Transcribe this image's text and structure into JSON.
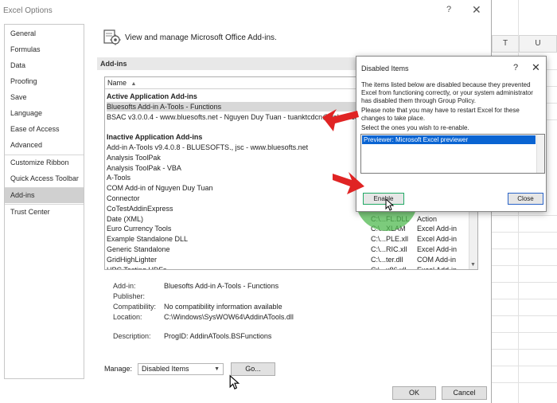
{
  "window": {
    "title": "Excel Options",
    "help": "?",
    "close": "✕"
  },
  "nav": {
    "items": [
      {
        "label": "General"
      },
      {
        "label": "Formulas"
      },
      {
        "label": "Data"
      },
      {
        "label": "Proofing"
      },
      {
        "label": "Save"
      },
      {
        "label": "Language"
      },
      {
        "label": "Ease of Access"
      },
      {
        "label": "Advanced"
      },
      {
        "label": "Customize Ribbon"
      },
      {
        "label": "Quick Access Toolbar"
      },
      {
        "label": "Add-ins"
      },
      {
        "label": "Trust Center"
      }
    ],
    "selected": "Add-ins"
  },
  "main": {
    "header": "View and manage Microsoft Office Add-ins.",
    "section": "Add-ins",
    "list_header": "Name",
    "rows": [
      {
        "name": "Active Application Add-ins",
        "loc": "",
        "type": "",
        "group": true
      },
      {
        "name": "Bluesofts Add-in A-Tools - Functions",
        "loc": "",
        "type": "",
        "hl": true
      },
      {
        "name": "BSAC v3.0.0.4 - www.bluesofts.net - Nguyen Duy Tuan - tuanktcdcn@yahoo.com",
        "loc": "",
        "type": ""
      },
      {
        "name": "",
        "loc": "",
        "type": ""
      },
      {
        "name": "Inactive Application Add-ins",
        "loc": "",
        "type": "",
        "group": true
      },
      {
        "name": "Add-in A-Tools v9.4.0.8 - BLUESOFTS., jsc - www.bluesofts.net",
        "loc": "",
        "type": ""
      },
      {
        "name": "Analysis ToolPak",
        "loc": "",
        "type": ""
      },
      {
        "name": "Analysis ToolPak - VBA",
        "loc": "",
        "type": ""
      },
      {
        "name": "A-Tools",
        "loc": "",
        "type": ""
      },
      {
        "name": "COM Add-in of Nguyen Duy Tuan",
        "loc": "",
        "type": ""
      },
      {
        "name": "Connector",
        "loc": "",
        "type": ""
      },
      {
        "name": "CoTestAddinExpress",
        "loc": "",
        "type": ""
      },
      {
        "name": "Date (XML)",
        "loc": "C:\\...FL.DLL",
        "type": "Action"
      },
      {
        "name": "Euro Currency Tools",
        "loc": "C:\\...XLAM",
        "type": "Excel Add-in"
      },
      {
        "name": "Example Standalone DLL",
        "loc": "C:\\...PLE.xll",
        "type": "Excel Add-in"
      },
      {
        "name": "Generic Standalone",
        "loc": "C:\\...RIC.xll",
        "type": "Excel Add-in"
      },
      {
        "name": "GridHighLighter",
        "loc": "C:\\...ter.dll",
        "type": "COM Add-in"
      },
      {
        "name": "HPC Testing UDFs",
        "loc": "C:\\...x86.xll",
        "type": "Excel Add-in"
      }
    ],
    "details": [
      {
        "label": "Add-in:",
        "value": "Bluesofts Add-in A-Tools - Functions"
      },
      {
        "label": "Publisher:",
        "value": ""
      },
      {
        "label": "Compatibility:",
        "value": "No compatibility information available"
      },
      {
        "label": "Location:",
        "value": "C:\\Windows\\SysWOW64\\AddinATools.dll"
      },
      {
        "label": "Description:",
        "value": "ProgID: AddinATools.BSFunctions"
      }
    ],
    "manage_label": "Manage:",
    "manage_value": "Disabled Items",
    "go_label": "Go...",
    "ok_label": "OK",
    "cancel_label": "Cancel"
  },
  "popup": {
    "title": "Disabled Items",
    "help": "?",
    "close": "✕",
    "text1": "The items listed below are disabled because they prevented Excel from functioning correctly, or your system administrator has disabled them through Group Policy.",
    "text2": "Please note that you may have to restart Excel for these changes to take place.",
    "text3": "Select the ones you wish to re-enable.",
    "list_item": "Previewer: Microsoft Excel previewer",
    "enable_label": "Enable",
    "close_label": "Close"
  },
  "excel": {
    "col_t": "T",
    "col_u": "U"
  },
  "colors": {
    "arrow": "#e02424",
    "highlight_circle": "#50b950",
    "selection": "#0a64d2"
  },
  "icons": [
    "addins-icon",
    "red-arrow-icon",
    "mouse-cursor-icon",
    "sort-up-icon",
    "dropdown-caret-icon"
  ]
}
